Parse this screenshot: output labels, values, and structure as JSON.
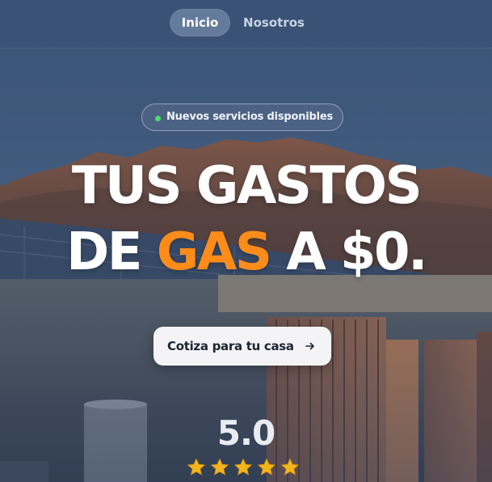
{
  "nav": {
    "items": [
      {
        "label": "Inicio",
        "active": true
      },
      {
        "label": "Nosotros",
        "active": false
      }
    ]
  },
  "badge": {
    "text": "Nuevos servicios disponibles",
    "dot_color": "#4ddb6e"
  },
  "headline": {
    "line1": "TUS GASTOS",
    "line2_prefix": "DE ",
    "line2_accent": "GAS",
    "line2_suffix": " A $0.",
    "accent_color": "#ff8c1a"
  },
  "cta": {
    "label": "Cotiza para tu casa",
    "icon": "arrow-right-icon"
  },
  "rating": {
    "score": "5.0",
    "stars": 5,
    "star_color": "#f2b51d"
  }
}
